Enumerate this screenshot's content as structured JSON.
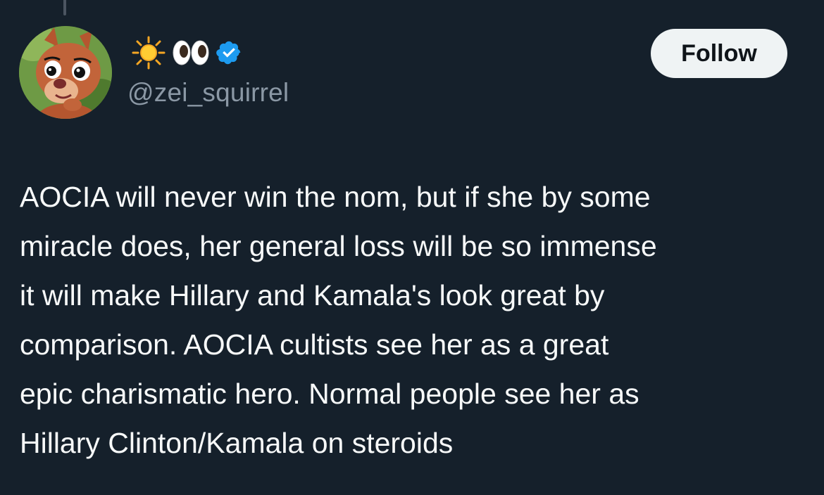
{
  "author": {
    "display_name_icons": [
      "sun-icon",
      "eyes-icon",
      "verified-badge-icon"
    ],
    "handle": "@zei_squirrel",
    "avatar": "squirrel-cartoon-avatar"
  },
  "follow_button": {
    "label": "Follow"
  },
  "tweet": {
    "lines": [
      "AOCIA will never win the nom, but if she by some",
      "miracle does, her general loss will be so immense",
      "it will make Hillary and Kamala's look great by",
      "comparison. AOCIA cultists see her as a great",
      "epic charismatic hero. Normal people see her as",
      "Hillary Clinton/Kamala on steroids"
    ]
  },
  "colors": {
    "background": "#15202b",
    "text": "#f7f9f9",
    "muted": "#8b98a5",
    "verified": "#1d9bf0",
    "button_bg": "#eff3f4"
  }
}
